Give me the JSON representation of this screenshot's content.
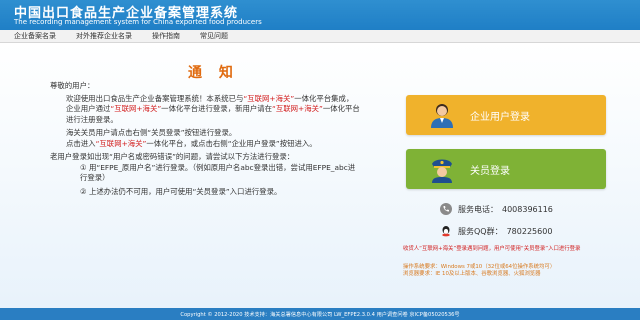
{
  "header": {
    "title": "中国出口食品生产企业备案管理系统",
    "subtitle": "The recording management system for China exported food producers"
  },
  "nav": {
    "items": [
      "企业备案名录",
      "对外推荐企业名录",
      "操作指南",
      "常见问题"
    ]
  },
  "notice": {
    "title": "通  知",
    "greeting": "尊敬的用户：",
    "p1_a": "欢迎使用出口食品生产企业备案管理系统！本系统已与",
    "p1_b": "“互联网+海关”",
    "p1_c": "一体化平台集成，企业用户通过",
    "p1_d": "“互联网+海关”",
    "p1_e": "一体化平台进行登录，新用户请在",
    "p1_f": "“互联网+海关”",
    "p1_g": "一体化平台进行注册登录。",
    "p2": "海关关员用户请点击右侧“关员登录”按钮进行登录。",
    "p3_a": "点击进入",
    "p3_b": "“互联网+海关”",
    "p3_c": "一体化平台，或点击右侧“企业用户登录”按钮进入。",
    "p4": "老用户登录如出现“用户名或密码错误”的问题，请尝试以下方法进行登录：",
    "p5": "① 用“EFPE_原用户名”进行登录。（例如原用户名abc登录出错，尝试用EFPE_abc进行登录）",
    "p6": "② 上述办法仍不可用，用户可使用“关员登录”入口进行登录。"
  },
  "buttons": {
    "enterprise": "企业用户登录",
    "customs": "关员登录"
  },
  "contact": {
    "phone_label": "服务电话：",
    "phone": "4008396116",
    "qq_label": "服务QQ群：",
    "qq": "780225600"
  },
  "notes": {
    "line1": "收货人“互联网+海关”登录遇到问题，用户可使用“关员登录”入口进行登录",
    "line2": "操作系统要求：Windows 7或10（32位或64位操作系统均可）",
    "line3": "浏览器要求：IE 10及以上版本、谷歌浏览器、火狐浏览器"
  },
  "footer": {
    "text": "Copyright © 2012-2020  技术支持：海关总署信息中心有限公司  LW_EFPE2.3.0.4  用户调查问卷  京ICP备05020536号"
  },
  "colors": {
    "header": "#1f7fc6",
    "title_orange": "#e06b10",
    "enterprise_button": "#f0b22c",
    "customs_button": "#7fb236",
    "highlight_red": "#d21d1d"
  }
}
